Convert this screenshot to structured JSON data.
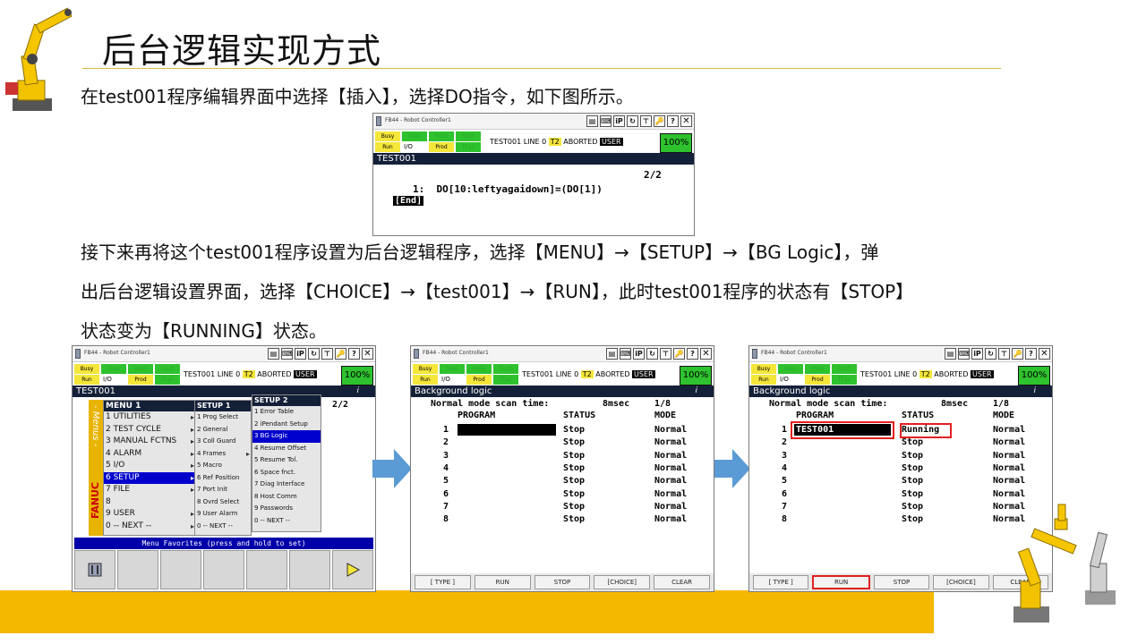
{
  "slide": {
    "title": "后台逻辑实现方式",
    "p1": "在test001程序编辑界面中选择【插入】，选择DO指令，如下图所示。",
    "p2": "接下来再将这个test001程序设置为后台逻辑程序，选择【MENU】→【SETUP】→【BG Logic】，弹",
    "p3": "出后台逻辑设置界面，选择【CHOICE】→【test001】→【RUN】，此时test001程序的状态有【STOP】",
    "p4": "状态变为【RUNNING】状态。"
  },
  "colors": {
    "accent_bar": "#f5b800",
    "header_bg": "#142038",
    "menu_blue": "#0000cc",
    "highlight_red": "#e32020",
    "led_green": "#2ec22e",
    "led_yellow": "#f5e63a"
  },
  "pendant": {
    "window_title": "FB44 - Robot Controller1",
    "tools": [
      "list-icon",
      "keyboard-icon",
      "ip-icon",
      "refresh-icon",
      "tree-icon",
      "key-icon",
      "help-icon",
      "close-icon"
    ],
    "tool_labels": [
      "▤",
      "⌨",
      "iP",
      "↻",
      "⊤",
      "🔑",
      "?",
      "✕"
    ],
    "leds_top": [
      "Busy",
      "Step",
      "Hold",
      "Fault"
    ],
    "leds_bottom": [
      "Run",
      "I/O",
      "Prod",
      "TCyc"
    ],
    "status_prefix": "TEST001 LINE 0",
    "status_t2": "T2",
    "status_aborted": "ABORTED",
    "status_user": "USER",
    "percent": "100%"
  },
  "screen1": {
    "header": "TEST001",
    "page": "2/2",
    "line1": "1:  DO[10:leftyagaidown]=(DO[1])",
    "end": "[End]"
  },
  "screen2": {
    "header": "TEST001",
    "header_i": "i",
    "page": "2/2",
    "side_label": "- Menus -",
    "brand": "FANUC",
    "menu1_title": "MENU  1",
    "menu1_items": [
      "1 UTILITIES",
      "2 TEST CYCLE",
      "3 MANUAL FCTNS",
      "4 ALARM",
      "5 I/O",
      "6 SETUP",
      "7 FILE",
      "8",
      "9 USER",
      "0 -- NEXT --"
    ],
    "setup1_title": "SETUP  1",
    "setup1_items": [
      "1 Prog Select",
      "2 General",
      "3 Coll Guard",
      "4 Frames",
      "5 Macro",
      "6 Ref Position",
      "7 Port Init",
      "8 Ovrd Select",
      "9 User Alarm",
      "0 -- NEXT --"
    ],
    "setup2_title": "SETUP  2",
    "setup2_items": [
      "1 Error Table",
      "2 iPendant Setup",
      "3 BG Logic",
      "4 Resume Offset",
      "5 Resume Tol.",
      "6 Space fnct.",
      "7 Diag Interface",
      "8 Host Comm",
      "9 Passwords",
      "0 -- NEXT --"
    ],
    "favorites": "Menu Favorites (press and hold to set)"
  },
  "bg_logic": {
    "header": "Background logic",
    "header_i": "i",
    "scan_label": "Normal mode scan time:",
    "scan_value": "8msec",
    "page": "1/8",
    "col_program": "PROGRAM",
    "col_status": "STATUS",
    "col_mode": "MODE",
    "row_numbers": [
      "1",
      "2",
      "3",
      "4",
      "5",
      "6",
      "7",
      "8"
    ],
    "before_status": [
      "Stop",
      "Stop",
      "Stop",
      "Stop",
      "Stop",
      "Stop",
      "Stop",
      "Stop"
    ],
    "after_program_1": "TEST001",
    "after_status": [
      "Running",
      "Stop",
      "Stop",
      "Stop",
      "Stop",
      "Stop",
      "Stop",
      "Stop"
    ],
    "modes": [
      "Normal",
      "Normal",
      "Normal",
      "Normal",
      "Normal",
      "Normal",
      "Normal",
      "Normal"
    ],
    "fkeys": [
      "[ TYPE ]",
      "RUN",
      "STOP",
      "[CHOICE]",
      "CLEAR"
    ]
  }
}
